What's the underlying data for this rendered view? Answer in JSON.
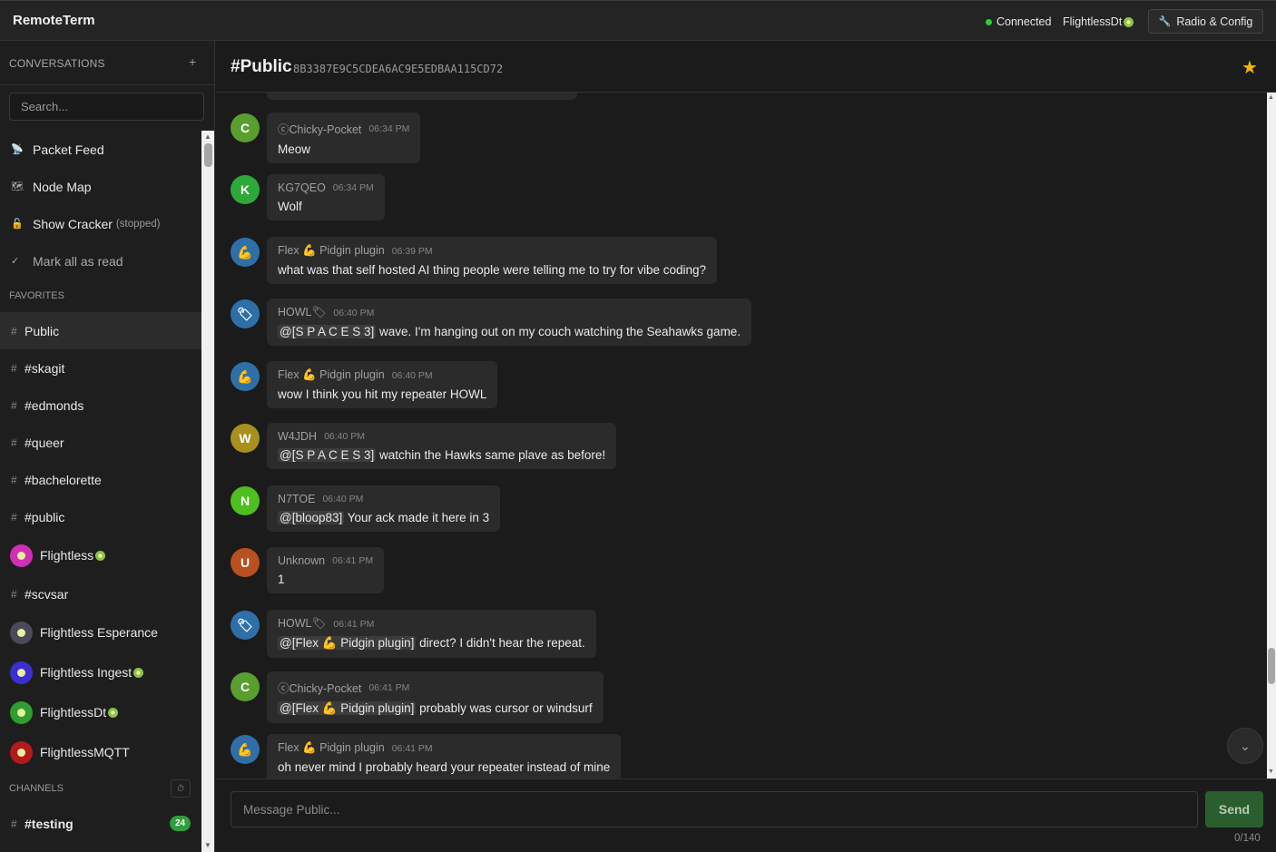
{
  "app": {
    "title": "RemoteTerm"
  },
  "topbar": {
    "status": "Connected",
    "device": "FlightlessDt",
    "radio_button": "Radio & Config"
  },
  "sidebar": {
    "header": "CONVERSATIONS",
    "add": "+",
    "search_placeholder": "Search...",
    "tools": [
      {
        "label": "Packet Feed",
        "icon": "satellite-icon"
      },
      {
        "label": "Node Map",
        "icon": "map-icon"
      },
      {
        "label": "Show Cracker",
        "sub": "(stopped)",
        "icon": "unlock-icon"
      },
      {
        "label": "Mark all as read",
        "icon": "check-icon"
      }
    ],
    "favorites_label": "FAVORITES",
    "favorites": [
      {
        "label": "Public",
        "type": "channel",
        "active": true
      },
      {
        "label": "#skagit",
        "type": "channel"
      },
      {
        "label": "#edmonds",
        "type": "channel"
      },
      {
        "label": "#queer",
        "type": "channel"
      },
      {
        "label": "#bachelorette",
        "type": "channel"
      },
      {
        "label": "#public",
        "type": "channel"
      },
      {
        "label": "Flightless",
        "type": "contact",
        "color": "#d12fb6",
        "badge": true
      },
      {
        "label": "#scvsar",
        "type": "channel"
      },
      {
        "label": "Flightless Esperance",
        "type": "contact",
        "color": "#4a4a5a"
      },
      {
        "label": "Flightless Ingest",
        "type": "contact",
        "color": "#3b2fd1",
        "badge": true
      },
      {
        "label": "FlightlessDt",
        "type": "contact",
        "color": "#2f9e2f",
        "badge": true
      },
      {
        "label": "FlightlessMQTT",
        "type": "contact",
        "color": "#b31b1b",
        "badge": false
      }
    ],
    "channels_label": "CHANNELS",
    "channels": [
      {
        "label": "#testing",
        "count": "24"
      }
    ]
  },
  "channel": {
    "title": "#Public",
    "key": "8B3387E9C5CDEA6AC9E5EDBAA115CD72",
    "input_placeholder": "Message Public...",
    "send": "Send",
    "char_count": "0/140"
  },
  "messages": [
    {
      "initial": "C",
      "color": "#5a9e2f",
      "name": "ⓒChicky-Pocket",
      "time": "06:34 PM",
      "text": "Meow"
    },
    {
      "initial": "K",
      "color": "#2fa83a",
      "name": "KG7QEO",
      "time": "06:34 PM",
      "text": "Wolf"
    },
    {
      "initial": "💪",
      "color": "#2f6fa8",
      "name": "Flex 💪 Pidgin plugin",
      "time": "06:39 PM",
      "text": "what was that self hosted AI thing people were telling me to try for vibe coding?"
    },
    {
      "initial": "🏷",
      "color": "#2f6fa8",
      "name": "HOWL🏷",
      "time": "06:40 PM",
      "mention": "@[S P A C E S 3]",
      "text": " wave. I'm hanging out on my couch watching the Seahawks game."
    },
    {
      "initial": "💪",
      "color": "#2f6fa8",
      "name": "Flex 💪 Pidgin plugin",
      "time": "06:40 PM",
      "text": "wow I think you hit my repeater HOWL"
    },
    {
      "initial": "W",
      "color": "#a8901f",
      "name": "W4JDH",
      "time": "06:40 PM",
      "mention": "@[S P A C E S 3]",
      "text": " watchin the Hawks same plave as before!"
    },
    {
      "initial": "N",
      "color": "#4fbe1f",
      "name": "N7TOE",
      "time": "06:40 PM",
      "mention": "@[bloop83]",
      "text": " Your ack made it here in 3"
    },
    {
      "initial": "U",
      "color": "#b8501f",
      "name": "Unknown",
      "time": "06:41 PM",
      "text": "1"
    },
    {
      "initial": "🏷",
      "color": "#2f6fa8",
      "name": "HOWL🏷",
      "time": "06:41 PM",
      "mention": "@[Flex 💪 Pidgin plugin]",
      "text": " direct? I didn't hear the repeat."
    },
    {
      "initial": "C",
      "color": "#5a9e2f",
      "name": "ⓒChicky-Pocket",
      "time": "06:41 PM",
      "mention": "@[Flex 💪 Pidgin plugin]",
      "text": " probably was cursor or windsurf"
    },
    {
      "initial": "💪",
      "color": "#2f6fa8",
      "name": "Flex 💪 Pidgin plugin",
      "time": "06:41 PM",
      "text": "oh never mind I probably heard your repeater instead of mine"
    }
  ]
}
